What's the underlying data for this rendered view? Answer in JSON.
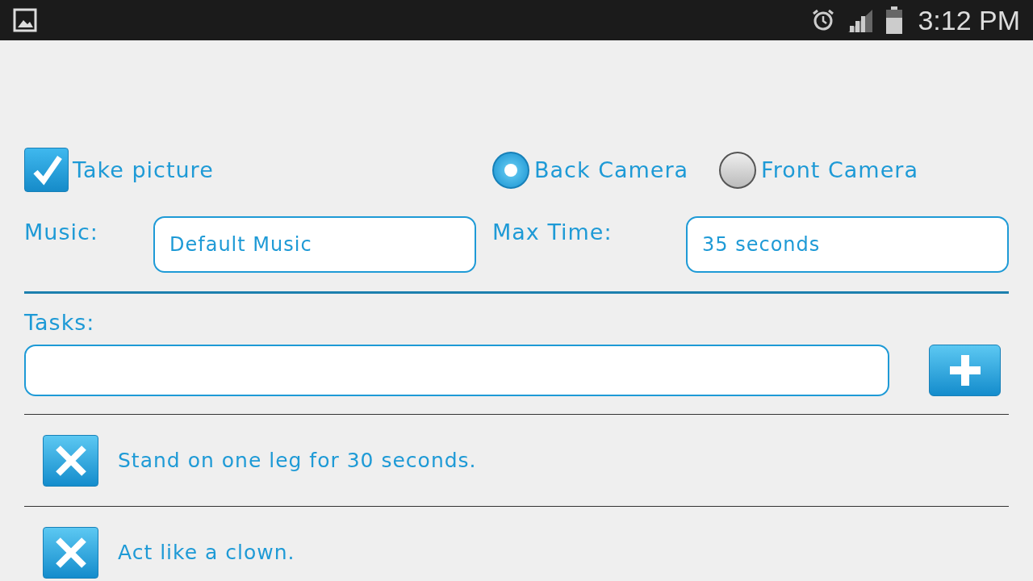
{
  "status_bar": {
    "time": "3:12 PM"
  },
  "take_picture": {
    "label": "Take picture",
    "checked": true
  },
  "camera_options": [
    {
      "label": "Back Camera",
      "selected": true
    },
    {
      "label": "Front Camera",
      "selected": false
    }
  ],
  "music": {
    "label": "Music:",
    "value": "Default Music"
  },
  "max_time": {
    "label": "Max Time:",
    "value": "35 seconds"
  },
  "tasks": {
    "label": "Tasks:",
    "items": [
      {
        "text": "Stand on one leg for 30 seconds."
      },
      {
        "text": "Act like a clown."
      }
    ]
  }
}
